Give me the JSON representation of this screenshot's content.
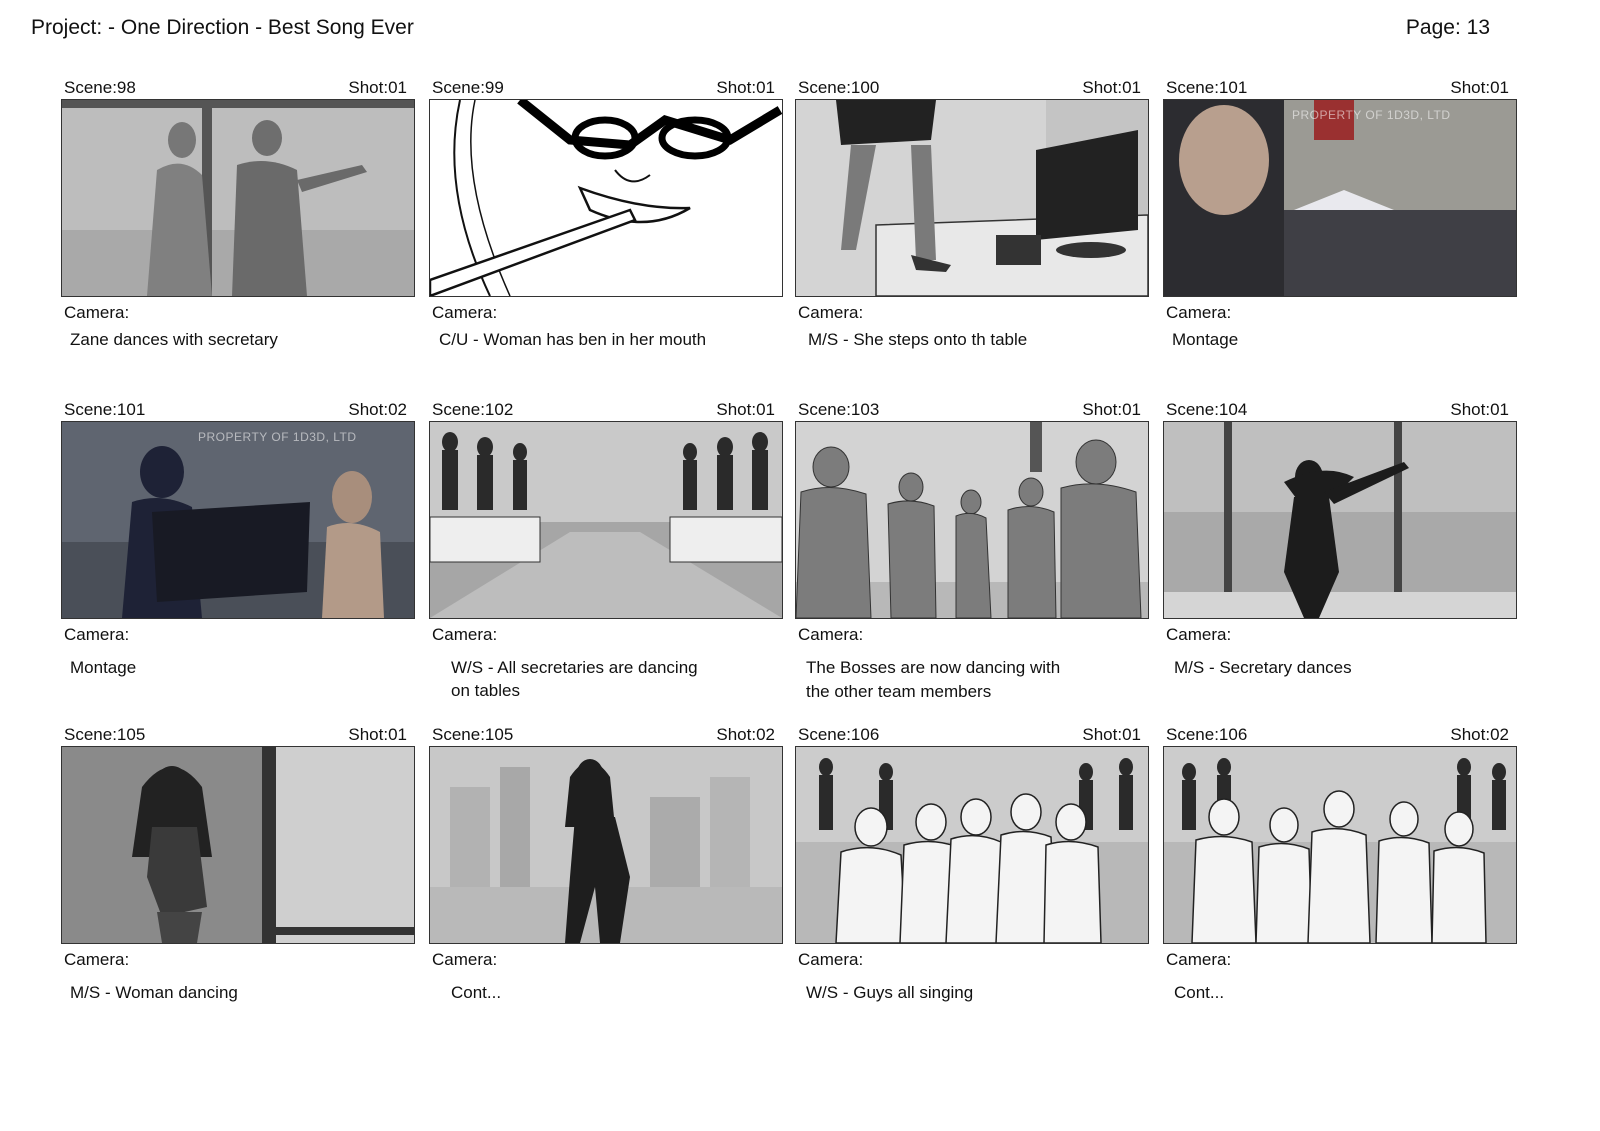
{
  "header": {
    "project": "Project:  - One Direction - Best Song Ever",
    "page": "Page: 13"
  },
  "camera_label": "Camera:",
  "panels": [
    {
      "scene": "Scene:98",
      "shot": "Shot:01",
      "description": "Zane dances with secretary"
    },
    {
      "scene": "Scene:99",
      "shot": "Shot:01",
      "description": "C/U - Woman has ben in her mouth"
    },
    {
      "scene": "Scene:100",
      "shot": "Shot:01",
      "description": "M/S - She steps onto th table"
    },
    {
      "scene": "Scene:101",
      "shot": "Shot:01",
      "description": "Montage",
      "watermark": "PROPERTY OF 1D3D, LTD"
    },
    {
      "scene": "Scene:101",
      "shot": "Shot:02",
      "description": "Montage",
      "watermark": "PROPERTY OF 1D3D, LTD"
    },
    {
      "scene": "Scene:102",
      "shot": "Shot:01",
      "description": "W/S - All secretaries are dancing",
      "description2": "on tables"
    },
    {
      "scene": "Scene:103",
      "shot": "Shot:01",
      "description": "The Bosses are now dancing with",
      "description2": "the other team members"
    },
    {
      "scene": "Scene:104",
      "shot": "Shot:01",
      "description": "M/S - Secretary dances"
    },
    {
      "scene": "Scene:105",
      "shot": "Shot:01",
      "description": "M/S - Woman dancing"
    },
    {
      "scene": "Scene:105",
      "shot": "Shot:02",
      "description": "Cont..."
    },
    {
      "scene": "Scene:106",
      "shot": "Shot:01",
      "description": "W/S - Guys all singing"
    },
    {
      "scene": "Scene:106",
      "shot": "Shot:02",
      "description": "Cont..."
    }
  ]
}
